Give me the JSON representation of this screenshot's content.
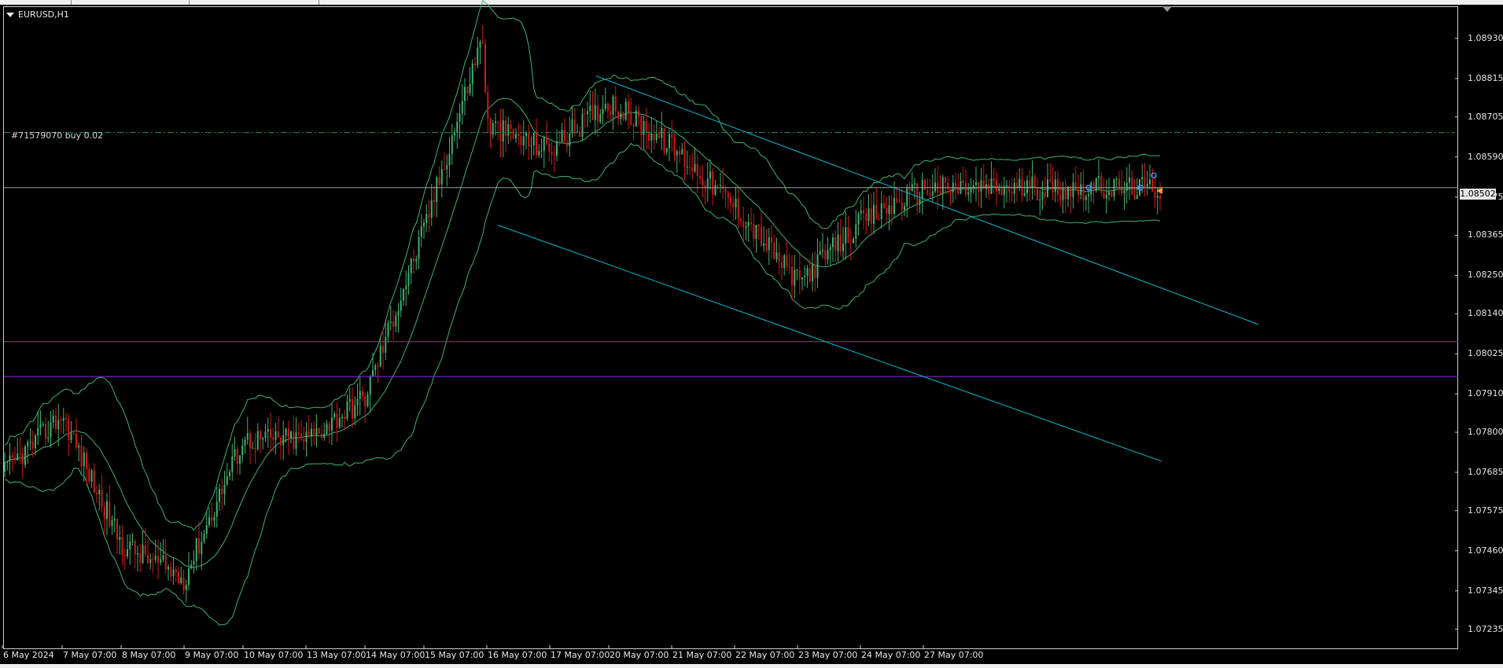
{
  "chart": {
    "symbol": "EURUSD,H1",
    "order_label": "#71579070 buy 0.02",
    "current_price": "1.08502",
    "price_ticks": [
      "1.08930",
      "1.08815",
      "1.08705",
      "1.08590",
      "1.08475",
      "1.08365",
      "1.08250",
      "1.08140",
      "1.08025",
      "1.07910",
      "1.07800",
      "1.07685",
      "1.07575",
      "1.07460",
      "1.07345",
      "1.07235"
    ],
    "time_ticks": [
      "6 May 2024",
      "7 May 07:00",
      "8 May 07:00",
      "9 May 07:00",
      "10 May 07:00",
      "13 May 07:00",
      "14 May 07:00",
      "15 May 07:00",
      "16 May 07:00",
      "17 May 07:00",
      "20 May 07:00",
      "21 May 07:00",
      "22 May 07:00",
      "23 May 07:00",
      "24 May 07:00",
      "27 May 07:00"
    ],
    "colors": {
      "background": "#000000",
      "bull_candle": "#3cb371",
      "bear_candle": "#d01818",
      "bollinger": "#3cb371",
      "channel": "#00bcd4",
      "horizontal_levels": "#8a2be2",
      "order_line": "#2e8b57",
      "bid_line": "#a0a0a0"
    }
  },
  "chart_data": {
    "type": "candlestick",
    "symbol": "EURUSD",
    "timeframe": "H1",
    "ylim": [
      1.0718,
      1.0902
    ],
    "x_ticks": [
      "6 May 2024",
      "7 May 07:00",
      "8 May 07:00",
      "9 May 07:00",
      "10 May 07:00",
      "13 May 07:00",
      "14 May 07:00",
      "15 May 07:00",
      "16 May 07:00",
      "17 May 07:00",
      "20 May 07:00",
      "21 May 07:00",
      "22 May 07:00",
      "23 May 07:00",
      "24 May 07:00",
      "27 May 07:00"
    ],
    "close_path": [
      {
        "at": "6 May 2024",
        "price": 1.0768
      },
      {
        "at": "7 May 07:00",
        "price": 1.0785
      },
      {
        "at": "8 May 07:00",
        "price": 1.0748
      },
      {
        "at": "9 May 07:00",
        "price": 1.0738
      },
      {
        "at": "10 May 07:00",
        "price": 1.0778
      },
      {
        "at": "13 May 07:00",
        "price": 1.0778
      },
      {
        "at": "14 May 07:00",
        "price": 1.079
      },
      {
        "at": "15 May 07:00",
        "price": 1.0838
      },
      {
        "at": "16 May 07:00",
        "price": 1.0868
      },
      {
        "at": "17 May 07:00",
        "price": 1.0861
      },
      {
        "at": "20 May 07:00",
        "price": 1.0875
      },
      {
        "at": "21 May 07:00",
        "price": 1.0862
      },
      {
        "at": "22 May 07:00",
        "price": 1.0845
      },
      {
        "at": "23 May 07:00",
        "price": 1.0823
      },
      {
        "at": "24 May 07:00",
        "price": 1.084
      },
      {
        "at": "27 May 07:00",
        "price": 1.085
      }
    ],
    "peak": {
      "price": 1.0894,
      "near": "16 May 07:00"
    },
    "horizontal_levels": [
      1.0806,
      1.0796
    ],
    "order_price": 1.0866,
    "bid": 1.08502,
    "channel_upper": [
      {
        "at": "16 May 07:00",
        "price": 1.0894
      },
      {
        "at": "27 May 07:00",
        "price": 1.0847
      }
    ],
    "channel_lower": [
      {
        "at": "14 May 07:00",
        "price": 1.0853
      },
      {
        "at": "27 May 07:00",
        "price": 1.0796
      }
    ]
  }
}
